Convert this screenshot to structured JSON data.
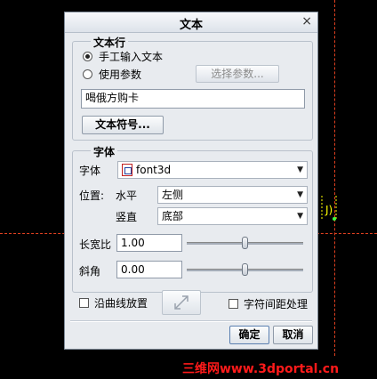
{
  "dialog": {
    "title": "文本",
    "close_symbol": "×",
    "text_line": {
      "group_title": "文本行",
      "manual_input_label": "手工输入文本",
      "use_param_label": "使用参数",
      "select_param_button": "选择参数...",
      "text_value": "喝俄方购卡",
      "text_symbol_button": "文本符号...",
      "selected_option": "manual"
    },
    "font": {
      "group_title": "字体",
      "font_label": "字体",
      "font_value": "font3d",
      "font_icon": "font-icon",
      "position_label": "位置:",
      "horizontal_label": "水平",
      "horizontal_value": "左侧",
      "vertical_label": "竖直",
      "vertical_value": "底部",
      "aspect_label": "长宽比",
      "aspect_value": "1.00",
      "aspect_slider_level": 0.5,
      "slant_label": "斜角",
      "slant_value": "0.00",
      "slant_slider_level": 0.5
    },
    "along_curve_label": "沿曲线放置",
    "kerning_label": "字符间距处理",
    "flip_icon": "flip-direction-icon",
    "ok_button": "确定",
    "cancel_button": "取消"
  },
  "watermark": "三维网www.3dportal.cn",
  "colors": {
    "dialog_bg": "#e8ebef",
    "canvas_bg": "#000000",
    "datum_line": "#e04020",
    "watermark": "#ff1a1a"
  }
}
